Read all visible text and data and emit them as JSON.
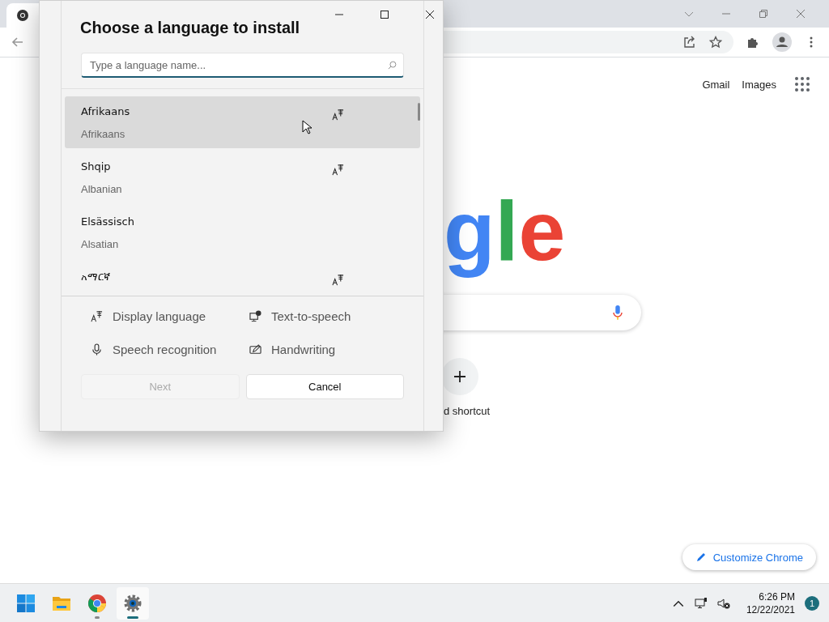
{
  "browser": {
    "header_links": [
      "Gmail",
      "Images"
    ],
    "logo_letters": [
      {
        "text": "g",
        "color": "#4285f4"
      },
      {
        "text": "l",
        "color": "#34a853"
      },
      {
        "text": "e",
        "color": "#ea4335"
      }
    ],
    "shortcut_label": "d shortcut",
    "customize_button": "Customize Chrome"
  },
  "dialog": {
    "title": "Choose a language to install",
    "search": {
      "placeholder": "Type a language name..."
    },
    "languages": [
      {
        "name": "Afrikaans",
        "english_name": "Afrikaans",
        "display_language": true,
        "selected": true
      },
      {
        "name": "Shqip",
        "english_name": "Albanian",
        "display_language": true,
        "selected": false
      },
      {
        "name": "Elsässisch",
        "english_name": "Alsatian",
        "display_language": false,
        "selected": false
      },
      {
        "name": "አማርኛ",
        "display_language": true,
        "selected": false
      }
    ],
    "features": [
      {
        "kind": "display",
        "label": "Display language"
      },
      {
        "kind": "tts",
        "label": "Text-to-speech"
      },
      {
        "kind": "speech",
        "label": "Speech recognition"
      },
      {
        "kind": "handwriting",
        "label": "Handwriting"
      }
    ],
    "buttons": [
      {
        "label": "Next",
        "disabled": true
      },
      {
        "label": "Cancel",
        "disabled": false
      }
    ]
  },
  "taskbar": {
    "apps": [
      {
        "kind": "start",
        "running": false,
        "active": false
      },
      {
        "kind": "explorer",
        "running": false,
        "active": false
      },
      {
        "kind": "chrome",
        "running": true,
        "active": false
      },
      {
        "kind": "settings",
        "running": true,
        "active": true
      }
    ],
    "time": "6:26 PM",
    "date": "12/22/2021",
    "notification_count": "1"
  }
}
